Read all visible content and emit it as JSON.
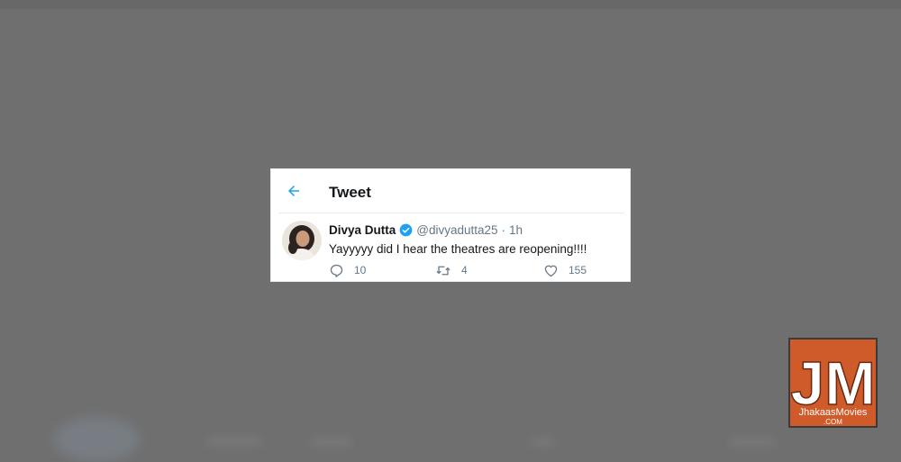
{
  "header": {
    "title": "Tweet"
  },
  "tweet": {
    "display_name": "Divya Dutta",
    "handle": "@divyadutta25",
    "separator": "·",
    "time": "1h",
    "text": "Yayyyyy did I hear the theatres are reopening!!!!",
    "reply_count": "10",
    "retweet_count": "4",
    "like_count": "155"
  },
  "logo": {
    "big_text": "JM",
    "brand": "JhakaasMovies",
    "suffix": ".COM"
  },
  "colors": {
    "accent": "#1da1f2",
    "backdrop": "#6f6f6f",
    "logo_bg": "#cf5a2a"
  },
  "icons": [
    "back-arrow-icon",
    "verified-badge-icon",
    "reply-icon",
    "retweet-icon",
    "like-icon"
  ]
}
